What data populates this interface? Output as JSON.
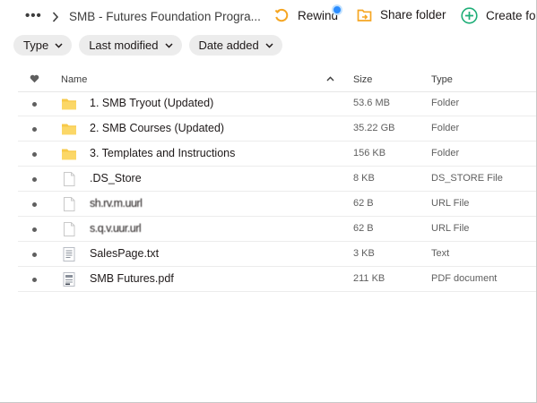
{
  "breadcrumb": {
    "more_label": "•••",
    "title": "SMB - Futures Foundation Progra..."
  },
  "actions": {
    "rewind_label": "Rewind",
    "share_label": "Share folder",
    "create_label": "Create fold"
  },
  "filters": [
    {
      "label": "Type"
    },
    {
      "label": "Last modified"
    },
    {
      "label": "Date added"
    }
  ],
  "columns": {
    "name": "Name",
    "size": "Size",
    "type": "Type"
  },
  "files": [
    {
      "name": "1. SMB Tryout (Updated)",
      "size": "53.6 MB",
      "type": "Folder",
      "icon": "folder-icon"
    },
    {
      "name": "2. SMB Courses (Updated)",
      "size": "35.22 GB",
      "type": "Folder",
      "icon": "folder-icon"
    },
    {
      "name": "3. Templates and Instructions",
      "size": "156 KB",
      "type": "Folder",
      "icon": "folder-icon"
    },
    {
      "name": ".DS_Store",
      "size": "8 KB",
      "type": "DS_STORE File",
      "icon": "file-icon"
    },
    {
      "name": "sh.rv.m.uurl",
      "size": "62 B",
      "type": "URL File",
      "icon": "file-icon"
    },
    {
      "name": "s.q.v.uur.url",
      "size": "62 B",
      "type": "URL File",
      "icon": "file-icon"
    },
    {
      "name": "SalesPage.txt",
      "size": "3 KB",
      "type": "Text",
      "icon": "text-file-icon"
    },
    {
      "name": "SMB Futures.pdf",
      "size": "211 KB",
      "type": "PDF document",
      "icon": "pdf-file-icon"
    }
  ],
  "colors": {
    "folder": "#f7c948",
    "accent_orange": "#f5a623",
    "accent_green": "#1fae78",
    "badge_blue": "#2a8cff"
  }
}
